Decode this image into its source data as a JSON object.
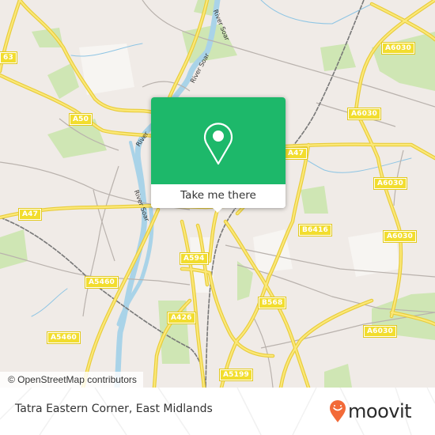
{
  "map": {
    "attribution": "© OpenStreetMap contributors",
    "road_labels": [
      {
        "id": "a6030-1",
        "text": "A6030"
      },
      {
        "id": "a563",
        "text": "63"
      },
      {
        "id": "a6030-2",
        "text": "A6030"
      },
      {
        "id": "a50",
        "text": "A50"
      },
      {
        "id": "a47-east",
        "text": "A47"
      },
      {
        "id": "a6030-3",
        "text": "A6030"
      },
      {
        "id": "a47-west",
        "text": "A47"
      },
      {
        "id": "b6416",
        "text": "B6416"
      },
      {
        "id": "a6030-4",
        "text": "A6030"
      },
      {
        "id": "a594",
        "text": "A594"
      },
      {
        "id": "a5460-1",
        "text": "A5460"
      },
      {
        "id": "b568",
        "text": "B568"
      },
      {
        "id": "a426",
        "text": "A426"
      },
      {
        "id": "a6030-5",
        "text": "A6030"
      },
      {
        "id": "a5460-2",
        "text": "A5460"
      },
      {
        "id": "a5199",
        "text": "A5199"
      }
    ],
    "river_labels": [
      {
        "id": "river-soar-north",
        "text": "River Soar"
      },
      {
        "id": "river-soar-top",
        "text": "River Soar"
      },
      {
        "id": "river-soar-mid",
        "text": "River Soar"
      },
      {
        "id": "river-soar-west",
        "text": "River"
      }
    ]
  },
  "popup": {
    "icon": "location-pin-icon",
    "button_label": "Take me there",
    "accent_color": "#1db86a"
  },
  "footer": {
    "place_name": "Tatra Eastern Corner, East Midlands",
    "brand": "moovit",
    "brand_color": "#f26a38"
  }
}
